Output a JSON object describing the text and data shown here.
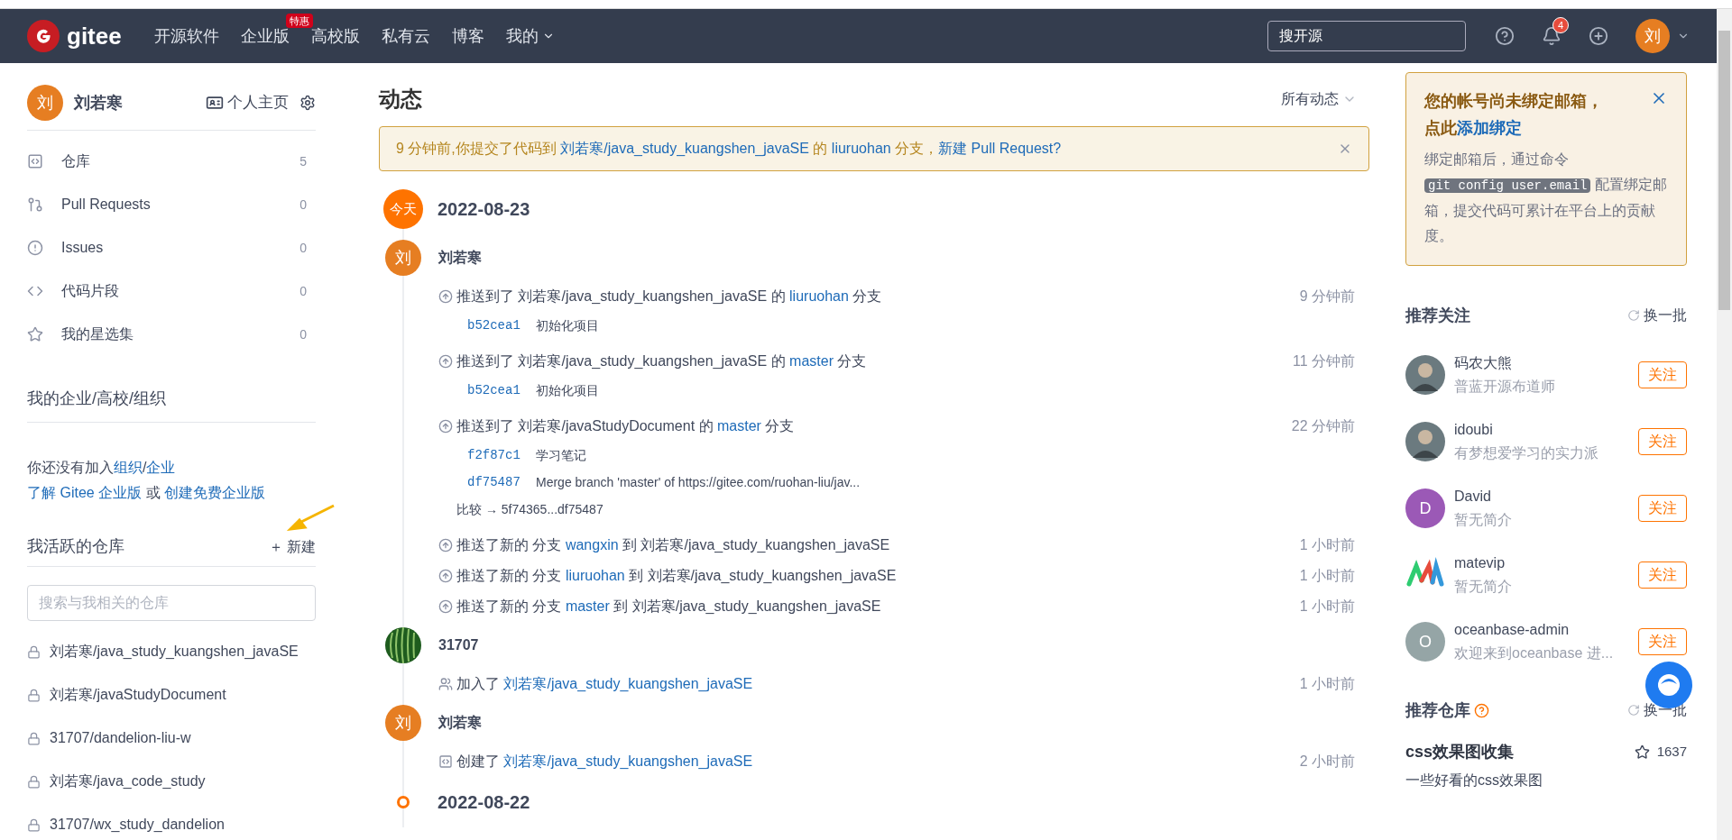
{
  "nav": {
    "logo": "gitee",
    "items": [
      {
        "label": "开源软件",
        "dropdown": false
      },
      {
        "label": "企业版",
        "badge": "特惠",
        "dropdown": false
      },
      {
        "label": "高校版",
        "dropdown": false
      },
      {
        "label": "私有云",
        "dropdown": false
      },
      {
        "label": "博客",
        "dropdown": false
      },
      {
        "label": "我的",
        "dropdown": true
      }
    ],
    "search": {
      "placeholder": "搜开源"
    },
    "notification_count": "4",
    "avatar": "刘"
  },
  "sidebar": {
    "user": {
      "avatar": "刘",
      "name": "刘若寒",
      "homepage": "个人主页"
    },
    "menu": [
      {
        "kind": "repo",
        "label": "仓库",
        "count": "5"
      },
      {
        "kind": "pr",
        "label": "Pull Requests",
        "count": "0"
      },
      {
        "kind": "issue",
        "label": "Issues",
        "count": "0"
      },
      {
        "kind": "snippet",
        "label": "代码片段",
        "count": "0"
      },
      {
        "kind": "star",
        "label": "我的星选集",
        "count": "0"
      }
    ],
    "org_title": "我的企业/高校/组织",
    "org_lines": [
      [
        {
          "text": "你还没有加入",
          "link": false
        },
        {
          "text": "组织",
          "link": true
        },
        {
          "text": "/",
          "link": false
        },
        {
          "text": "企业",
          "link": true
        }
      ],
      [
        {
          "text": "了解 Gitee 企业版",
          "link": true
        },
        {
          "text": " 或 ",
          "link": false
        },
        {
          "text": "创建免费企业版",
          "link": true
        }
      ]
    ],
    "repos_title": "我活跃的仓库",
    "new_label": "＋ 新建",
    "repo_search": {
      "placeholder": "搜索与我相关的仓库"
    },
    "repos": [
      "刘若寒/java_study_kuangshen_javaSE",
      "刘若寒/javaStudyDocument",
      "31707/dandelion-liu-w",
      "刘若寒/java_code_study",
      "31707/wx_study_dandelion"
    ]
  },
  "feed": {
    "title": "动态",
    "filter": "所有动态",
    "notice": [
      {
        "text": "9 分钟前,你提交了代码到 ",
        "link": false
      },
      {
        "text": "刘若寒/java_study_kuangshen_javaSE",
        "link": true
      },
      {
        "text": " 的 ",
        "link": false
      },
      {
        "text": "liuruohan",
        "link": true
      },
      {
        "text": " 分支，",
        "link": false
      },
      {
        "text": "新建 Pull Request?",
        "link": true
      }
    ],
    "days": [
      {
        "kind": "today",
        "marker": "今天",
        "date": "2022-08-23",
        "groups": [
          {
            "avatar": {
              "kind": "letter",
              "letter": "刘"
            },
            "name": "刘若寒",
            "events": [
              {
                "kind": "push",
                "parts": [
                  {
                    "text": "推送到了 刘若寒/java_study_kuangshen_javaSE 的 ",
                    "link": false
                  },
                  {
                    "text": "liuruohan",
                    "link": true
                  },
                  {
                    "text": " 分支",
                    "link": false
                  }
                ],
                "time": "9 分钟前",
                "commits": [
                  {
                    "sha": "b52cea1",
                    "message": "初始化项目"
                  }
                ]
              },
              {
                "kind": "push",
                "parts": [
                  {
                    "text": "推送到了 刘若寒/java_study_kuangshen_javaSE 的 ",
                    "link": false
                  },
                  {
                    "text": "master",
                    "link": true
                  },
                  {
                    "text": " 分支",
                    "link": false
                  }
                ],
                "time": "11 分钟前",
                "commits": [
                  {
                    "sha": "b52cea1",
                    "message": "初始化项目"
                  }
                ]
              },
              {
                "kind": "push",
                "parts": [
                  {
                    "text": "推送到了 刘若寒/javaStudyDocument 的 ",
                    "link": false
                  },
                  {
                    "text": "master",
                    "link": true
                  },
                  {
                    "text": " 分支",
                    "link": false
                  }
                ],
                "time": "22 分钟前",
                "commits": [
                  {
                    "sha": "f2f87c1",
                    "message": "学习笔记"
                  },
                  {
                    "sha": "df75487",
                    "message": "Merge branch 'master' of https://gitee.com/ruohan-liu/jav..."
                  }
                ],
                "compare": "比较 → 5f74365...df75487"
              },
              {
                "kind": "push",
                "parts": [
                  {
                    "text": "推送了新的 分支 ",
                    "link": false
                  },
                  {
                    "text": "wangxin",
                    "link": true
                  },
                  {
                    "text": " 到 刘若寒/java_study_kuangshen_javaSE",
                    "link": false
                  }
                ],
                "time": "1 小时前"
              },
              {
                "kind": "push",
                "parts": [
                  {
                    "text": "推送了新的 分支 ",
                    "link": false
                  },
                  {
                    "text": "liuruohan",
                    "link": true
                  },
                  {
                    "text": " 到 刘若寒/java_study_kuangshen_javaSE",
                    "link": false
                  }
                ],
                "time": "1 小时前"
              },
              {
                "kind": "push",
                "parts": [
                  {
                    "text": "推送了新的 分支 ",
                    "link": false
                  },
                  {
                    "text": "master",
                    "link": true
                  },
                  {
                    "text": " 到 刘若寒/java_study_kuangshen_javaSE",
                    "link": false
                  }
                ],
                "time": "1 小时前"
              }
            ]
          },
          {
            "avatar": {
              "kind": "picture"
            },
            "name": "31707",
            "events": [
              {
                "kind": "join",
                "parts": [
                  {
                    "text": "加入了 ",
                    "link": false
                  },
                  {
                    "text": "刘若寒/java_study_kuangshen_javaSE",
                    "link": true
                  }
                ],
                "time": "1 小时前"
              }
            ]
          },
          {
            "avatar": {
              "kind": "letter",
              "letter": "刘"
            },
            "name": "刘若寒",
            "events": [
              {
                "kind": "create",
                "parts": [
                  {
                    "text": "创建了 ",
                    "link": false
                  },
                  {
                    "text": "刘若寒/java_study_kuangshen_javaSE",
                    "link": true
                  }
                ],
                "time": "2 小时前"
              }
            ]
          }
        ]
      },
      {
        "kind": "past",
        "date": "2022-08-22"
      }
    ]
  },
  "right": {
    "email_notice": {
      "title": "您的帐号尚未绑定邮箱，",
      "title2": "点此",
      "link": "添加绑定",
      "body1": "绑定邮箱后，通过命令",
      "code": "git config user.email",
      "body2": "配置绑定邮箱，提交代码可累计在平台上的贡献度。"
    },
    "follow_title": "推荐关注",
    "refresh": "换一批",
    "follows": [
      {
        "avatar": {
          "kind": "photo"
        },
        "name": "码农大熊",
        "bio": "普蓝开源布道师",
        "button": "关注"
      },
      {
        "avatar": {
          "kind": "photo"
        },
        "name": "idoubi",
        "bio": "有梦想爱学习的实力派",
        "button": "关注"
      },
      {
        "avatar": {
          "kind": "letter",
          "letter": "D",
          "color": "#9b59b6"
        },
        "name": "David",
        "bio": "暂无简介",
        "button": "关注"
      },
      {
        "avatar": {
          "kind": "logo"
        },
        "name": "matevip",
        "bio": "暂无简介",
        "button": "关注"
      },
      {
        "avatar": {
          "kind": "letter",
          "letter": "O",
          "color": "#95a5a6"
        },
        "name": "oceanbase-admin",
        "bio": "欢迎来到oceanbase 进...",
        "button": "关注"
      }
    ],
    "repos_title": "推荐仓库",
    "repos_refresh": "换一批",
    "repos": [
      {
        "name": "css效果图收集",
        "stars": "1637",
        "description": "一些好看的css效果图"
      }
    ]
  }
}
